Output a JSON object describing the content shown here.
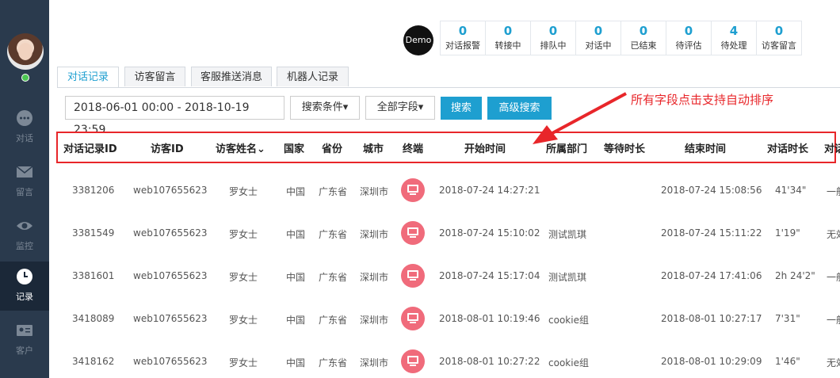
{
  "sidebar": {
    "items": [
      {
        "label": "对话",
        "icon": "chat-bubble-icon"
      },
      {
        "label": "留言",
        "icon": "envelope-icon"
      },
      {
        "label": "监控",
        "icon": "eye-icon"
      },
      {
        "label": "记录",
        "icon": "clock-icon"
      },
      {
        "label": "客户",
        "icon": "contact-card-icon"
      }
    ]
  },
  "header": {
    "demo_badge": "Demo",
    "stats": [
      {
        "value": "0",
        "label": "对话报警"
      },
      {
        "value": "0",
        "label": "转接中"
      },
      {
        "value": "0",
        "label": "排队中"
      },
      {
        "value": "0",
        "label": "对话中"
      },
      {
        "value": "0",
        "label": "已结束"
      },
      {
        "value": "0",
        "label": "待评估"
      },
      {
        "value": "4",
        "label": "待处理"
      },
      {
        "value": "0",
        "label": "访客留言"
      }
    ]
  },
  "tabs": [
    "对话记录",
    "访客留言",
    "客服推送消息",
    "机器人记录"
  ],
  "filters": {
    "date_range": "2018-06-01 00:00  -  2018-10-19 23:59",
    "search_conditions": "搜索条件",
    "all_fields": "全部字段",
    "search": "搜索",
    "advanced_search": "高级搜索"
  },
  "annotation": "所有字段点击支持自动排序",
  "table": {
    "columns": [
      "对话记录ID",
      "访客ID",
      "访客姓名",
      "国家",
      "省份",
      "城市",
      "终端",
      "开始时间",
      "所属部门",
      "等待时长",
      "结束时间",
      "对话时长",
      "对话"
    ],
    "rows": [
      {
        "id": "3381206",
        "visitor_id": "web107655623",
        "name": "罗女士",
        "country": "中国",
        "province": "广东省",
        "city": "深圳市",
        "start": "2018-07-24 14:27:21",
        "dept": "",
        "end": "2018-07-24 15:08:56",
        "duration": "41'34\"",
        "extra": "一般"
      },
      {
        "id": "3381549",
        "visitor_id": "web107655623",
        "name": "罗女士",
        "country": "中国",
        "province": "广东省",
        "city": "深圳市",
        "start": "2018-07-24 15:10:02",
        "dept": "测试凯琪",
        "end": "2018-07-24 15:11:22",
        "duration": "1'19\"",
        "extra": "无效"
      },
      {
        "id": "3381601",
        "visitor_id": "web107655623",
        "name": "罗女士",
        "country": "中国",
        "province": "广东省",
        "city": "深圳市",
        "start": "2018-07-24 15:17:04",
        "dept": "测试凯琪",
        "end": "2018-07-24 17:41:06",
        "duration": "2h 24'2\"",
        "extra": "一般"
      },
      {
        "id": "3418089",
        "visitor_id": "web107655623",
        "name": "罗女士",
        "country": "中国",
        "province": "广东省",
        "city": "深圳市",
        "start": "2018-08-01 10:19:46",
        "dept": "cookie组",
        "end": "2018-08-01 10:27:17",
        "duration": "7'31\"",
        "extra": "一般"
      },
      {
        "id": "3418162",
        "visitor_id": "web107655623",
        "name": "罗女士",
        "country": "中国",
        "province": "广东省",
        "city": "深圳市",
        "start": "2018-08-01 10:27:22",
        "dept": "cookie组",
        "end": "2018-08-01 10:29:09",
        "duration": "1'46\"",
        "extra": "无效"
      }
    ]
  },
  "colors": {
    "accent": "#1e9fd0",
    "annotation": "#e8262a",
    "sidebar": "#2a3a4d",
    "terminal_icon": "#f06b7b"
  }
}
